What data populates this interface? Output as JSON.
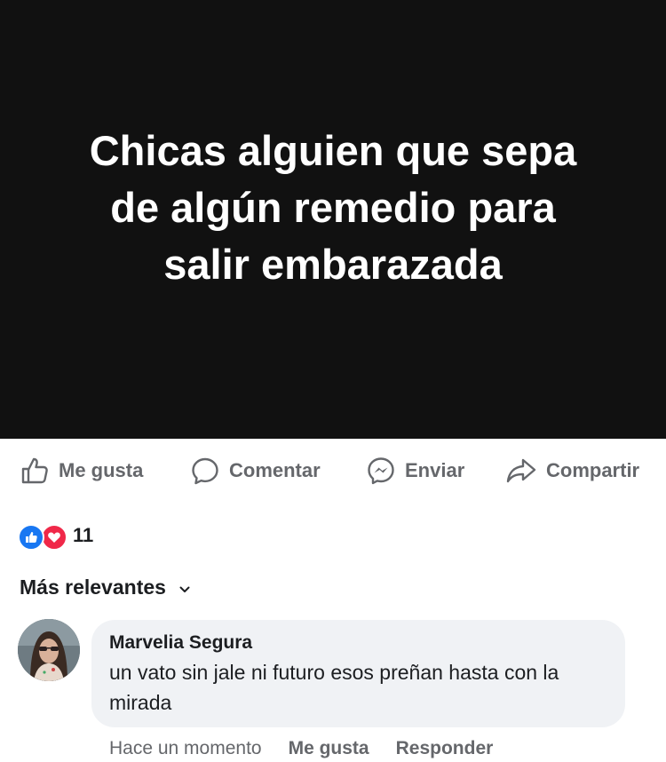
{
  "post": {
    "text": "Chicas alguien que sepa\nde algún remedio para\nsalir embarazada",
    "background_color": "#111111"
  },
  "actions": {
    "like_label": "Me gusta",
    "comment_label": "Comentar",
    "send_label": "Enviar",
    "share_label": "Compartir"
  },
  "reactions": {
    "count": "11",
    "types": [
      "like-icon",
      "love-icon"
    ],
    "like_color": "#1877f2",
    "love_color": "#f02849"
  },
  "comments_sort": {
    "label": "Más relevantes"
  },
  "comments": [
    {
      "author": "Marvelia Segura",
      "text": "un vato sin jale ni futuro esos preñan hasta con la mirada",
      "time": "Hace un momento",
      "like_label": "Me gusta",
      "reply_label": "Responder"
    }
  ],
  "colors": {
    "secondary_text": "#65676b",
    "bubble": "#f0f2f5"
  }
}
